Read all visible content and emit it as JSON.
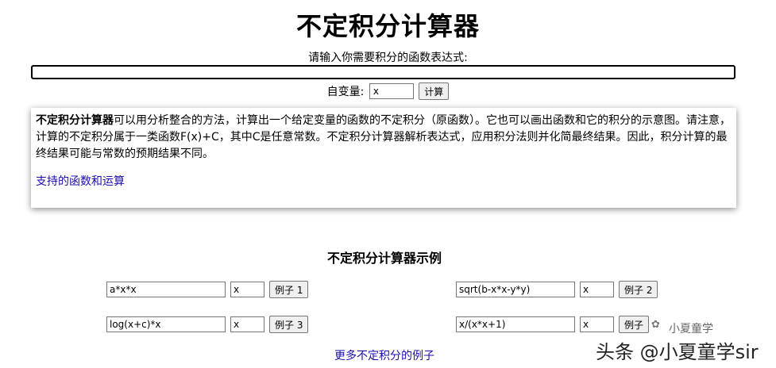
{
  "title": "不定积分计算器",
  "prompt": "请输入你需要积分的函数表达式:",
  "expression_value": "",
  "variable": {
    "label": "自变量:",
    "value": "x",
    "button": "计算"
  },
  "info": {
    "bold_lead": "不定积分计算器",
    "text": "可以用分析整合的方法，计算出一个给定变量的函数的不定积分（原函数）。它也可以画出函数和它的积分的示意图。请注意，计算的不定积分属于一类函数F(x)+C，其中C是任意常数。不定积分计算器解析表达式，应用积分法则并化简最终结果。因此，积分计算的最终结果可能与常数的预期结果不同。",
    "link": "支持的函数和运算"
  },
  "examples_title": "不定积分计算器示例",
  "examples": [
    {
      "expr": "a*x*x",
      "var": "x",
      "button": "例子 1"
    },
    {
      "expr": "sqrt(b-x*x-y*y)",
      "var": "x",
      "button": "例子 2"
    },
    {
      "expr": "log(x+c)*x",
      "var": "x",
      "button": "例子 3"
    },
    {
      "expr": "x/(x*x+1)",
      "var": "x",
      "button": "例子"
    }
  ],
  "more_link": "更多不定积分的例子",
  "watermark": {
    "small": "小夏童学",
    "large": "头条 @小夏童学sir"
  }
}
